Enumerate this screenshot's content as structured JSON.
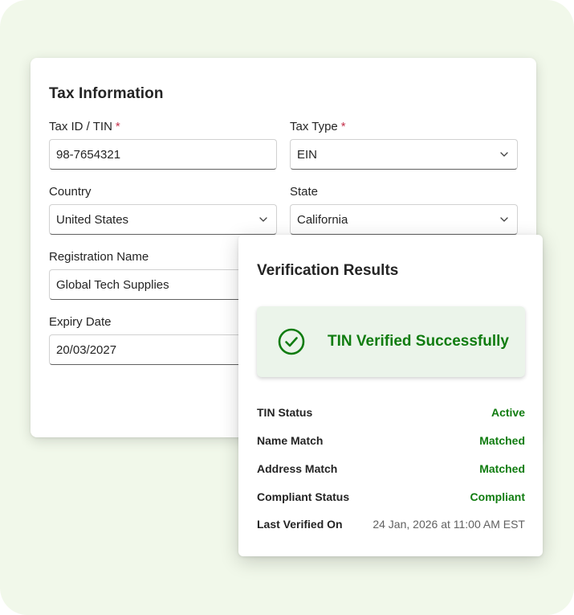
{
  "tax_form": {
    "title": "Tax Information",
    "required_marker": "*",
    "fields": {
      "tax_id": {
        "label": "Tax ID / TIN",
        "value": "98-7654321",
        "required": true
      },
      "tax_type": {
        "label": "Tax Type",
        "value": "EIN",
        "required": true,
        "type": "select"
      },
      "country": {
        "label": "Country",
        "value": "United States",
        "type": "select"
      },
      "state": {
        "label": "State",
        "value": "California",
        "type": "select"
      },
      "registration_name": {
        "label": "Registration Name",
        "value": "Global Tech Supplies"
      },
      "expiry_date": {
        "label": "Expiry Date",
        "value": "20/03/2027"
      }
    }
  },
  "verification": {
    "title": "Verification Results",
    "banner": {
      "icon": "check-circle-icon",
      "text": "TIN Verified Successfully",
      "color": "#107c10"
    },
    "results": [
      {
        "label": "TIN Status",
        "value": "Active"
      },
      {
        "label": "Name Match",
        "value": "Matched"
      },
      {
        "label": "Address Match",
        "value": "Matched"
      },
      {
        "label": "Compliant Status",
        "value": "Compliant"
      },
      {
        "label": "Last Verified On",
        "value": "24 Jan, 2026 at 11:00 AM EST"
      }
    ]
  },
  "colors": {
    "background": "#f1f8ea",
    "success": "#107c10",
    "required": "#c4314b"
  }
}
